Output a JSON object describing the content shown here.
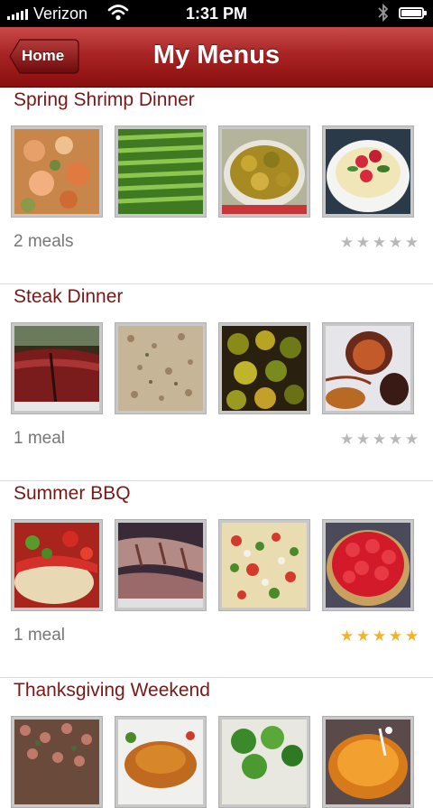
{
  "status_bar": {
    "carrier": "Verizon",
    "time": "1:31 PM"
  },
  "nav": {
    "back_label": "Home",
    "title": "My Menus"
  },
  "menus": [
    {
      "title": "Spring Shrimp Dinner",
      "meals": "2 meals",
      "rating": 0,
      "thumbs": [
        "shrimp",
        "asparagus",
        "potatoes",
        "panna-cotta"
      ]
    },
    {
      "title": "Steak Dinner",
      "meals": "1 meal",
      "rating": 0,
      "thumbs": [
        "steak",
        "risotto",
        "brussels-sprouts",
        "figs"
      ]
    },
    {
      "title": "Summer BBQ",
      "meals": "1 meal",
      "rating": 5,
      "thumbs": [
        "bruschetta",
        "ribs",
        "pasta-salad",
        "berry-tart"
      ]
    },
    {
      "title": "Thanksgiving Weekend",
      "meals": "",
      "rating": 0,
      "thumbs": [
        "stuffing",
        "turkey",
        "broccoli",
        "pumpkin-soup"
      ]
    }
  ],
  "colors": {
    "nav_red": "#a82424",
    "title_red": "#7a1717",
    "star_on": "#f2b22a",
    "star_off": "#b8b8b8"
  }
}
